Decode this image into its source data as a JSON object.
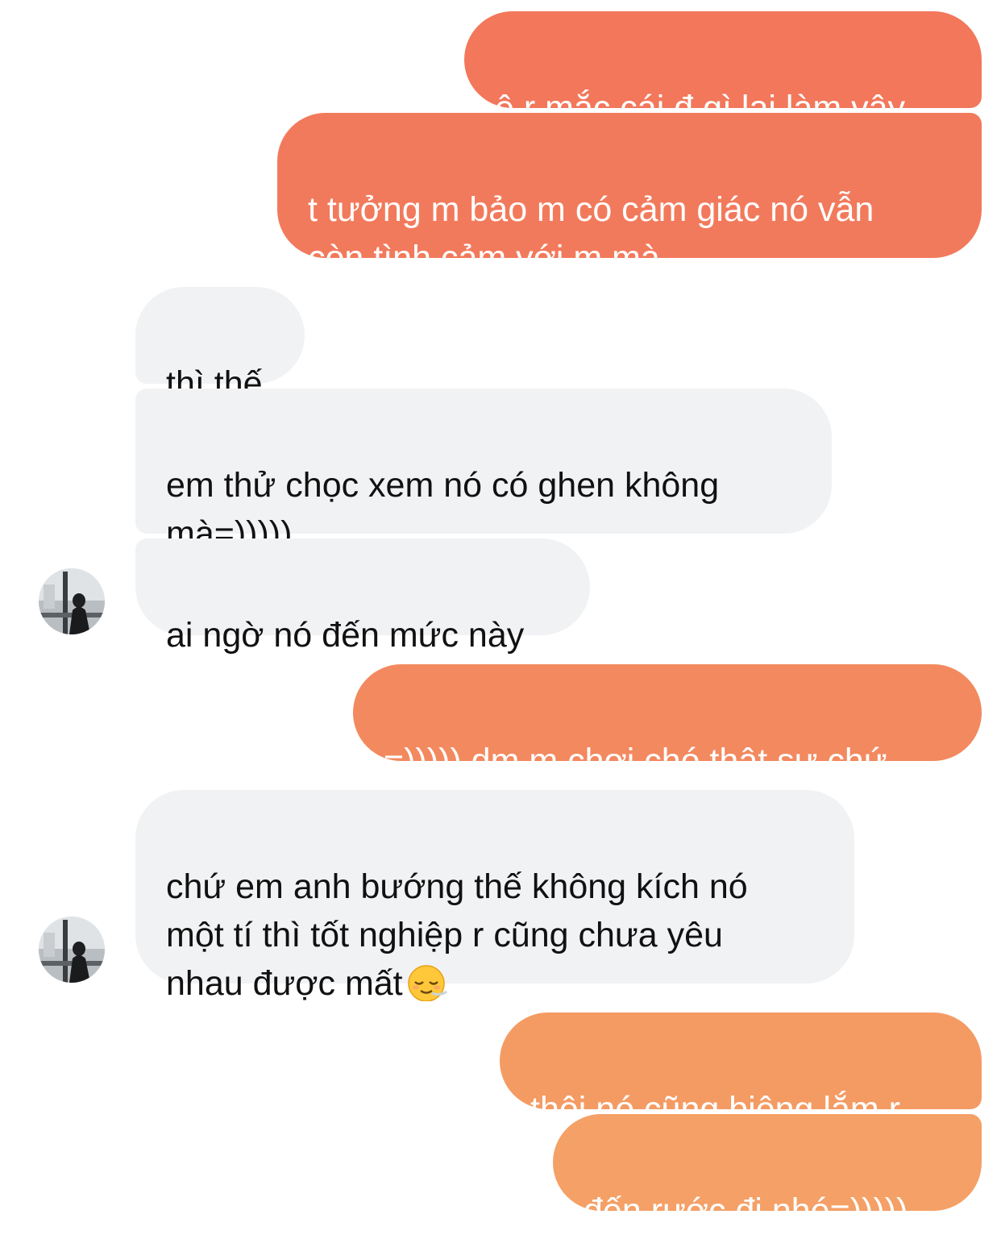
{
  "messages": [
    {
      "from": "me",
      "text": "ê r mắc cái đ gì lại làm vậy",
      "color": "#F2775B"
    },
    {
      "from": "me",
      "text": "t tưởng m bảo m có cảm giác nó vẫn\ncòn tình cảm với m mà",
      "color": "#F27A5C"
    },
    {
      "from": "them",
      "text": "thì thế"
    },
    {
      "from": "them",
      "text": "em thử chọc xem nó có ghen không\nmà=)))))"
    },
    {
      "from": "them",
      "text": "ai ngờ nó đến mức này"
    },
    {
      "from": "me",
      "text": "=))))) dm m chơi chó thật sự chứ",
      "color": "#F3895F"
    },
    {
      "from": "them",
      "text": "chứ em anh bướng thế không kích nó\nmột tí thì tốt nghiệp r cũng chưa yêu\nnhau được mất",
      "emoji": "relieved-face-emoji"
    },
    {
      "from": "me",
      "text": "thôi nó cũng biêng lắm r",
      "color": "#F49B64"
    },
    {
      "from": "me",
      "text": "đến rước đi nhé=)))))",
      "color": "#F4A066"
    }
  ]
}
